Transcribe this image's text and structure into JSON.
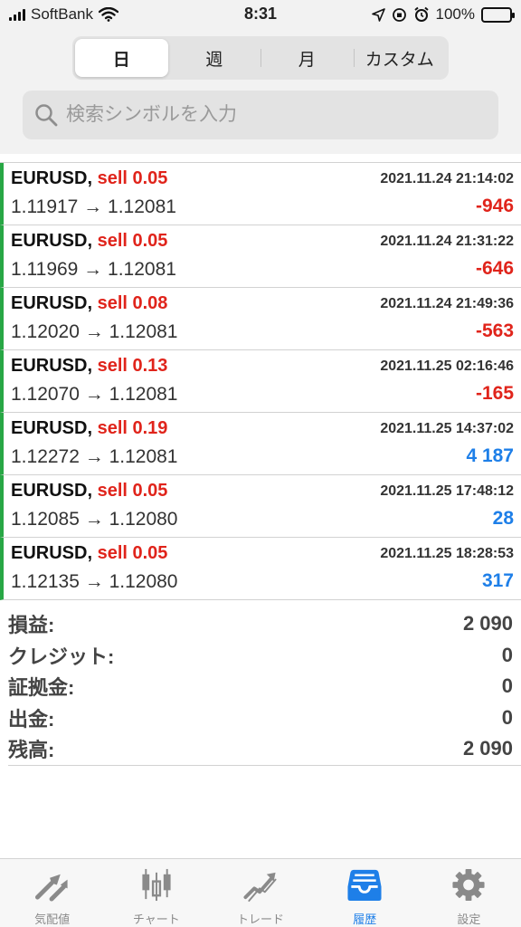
{
  "status_bar": {
    "carrier": "SoftBank",
    "time": "8:31",
    "battery": "100%"
  },
  "period_tabs": [
    {
      "label": "日",
      "active": true
    },
    {
      "label": "週",
      "active": false
    },
    {
      "label": "月",
      "active": false
    },
    {
      "label": "カスタム",
      "active": false
    }
  ],
  "search": {
    "placeholder": "検索シンボルを入力"
  },
  "deals": [
    {
      "symbol": "EURUSD,",
      "side": "sell 0.05",
      "time": "2021.11.24 21:14:02",
      "prices": "1.11917 → 1.12081",
      "profit": "-946",
      "sign": "neg"
    },
    {
      "symbol": "EURUSD,",
      "side": "sell 0.05",
      "time": "2021.11.24 21:31:22",
      "prices": "1.11969 → 1.12081",
      "profit": "-646",
      "sign": "neg"
    },
    {
      "symbol": "EURUSD,",
      "side": "sell 0.08",
      "time": "2021.11.24 21:49:36",
      "prices": "1.12020 → 1.12081",
      "profit": "-563",
      "sign": "neg"
    },
    {
      "symbol": "EURUSD,",
      "side": "sell 0.13",
      "time": "2021.11.25 02:16:46",
      "prices": "1.12070 → 1.12081",
      "profit": "-165",
      "sign": "neg"
    },
    {
      "symbol": "EURUSD,",
      "side": "sell 0.19",
      "time": "2021.11.25 14:37:02",
      "prices": "1.12272 → 1.12081",
      "profit": "4 187",
      "sign": "pos"
    },
    {
      "symbol": "EURUSD,",
      "side": "sell 0.05",
      "time": "2021.11.25 17:48:12",
      "prices": "1.12085 → 1.12080",
      "profit": "28",
      "sign": "pos"
    },
    {
      "symbol": "EURUSD,",
      "side": "sell 0.05",
      "time": "2021.11.25 18:28:53",
      "prices": "1.12135 → 1.12080",
      "profit": "317",
      "sign": "pos"
    }
  ],
  "summary": [
    {
      "label": "損益:",
      "value": "2 090"
    },
    {
      "label": "クレジット:",
      "value": "0"
    },
    {
      "label": "証拠金:",
      "value": "0"
    },
    {
      "label": "出金:",
      "value": "0"
    },
    {
      "label": "残高:",
      "value": "2 090"
    }
  ],
  "tabbar": [
    {
      "label": "気配値",
      "icon": "quotes-icon",
      "active": false
    },
    {
      "label": "チャート",
      "icon": "chart-icon",
      "active": false
    },
    {
      "label": "トレード",
      "icon": "trade-icon",
      "active": false
    },
    {
      "label": "履歴",
      "icon": "history-icon",
      "active": true
    },
    {
      "label": "設定",
      "icon": "gear-icon",
      "active": false
    }
  ],
  "colors": {
    "sell": "#e0241b",
    "loss": "#e0241b",
    "gain": "#1e7fe8",
    "accent": "#1e7fe8",
    "row_marker": "#28a745",
    "inactive_tab": "#8a8a8a"
  }
}
